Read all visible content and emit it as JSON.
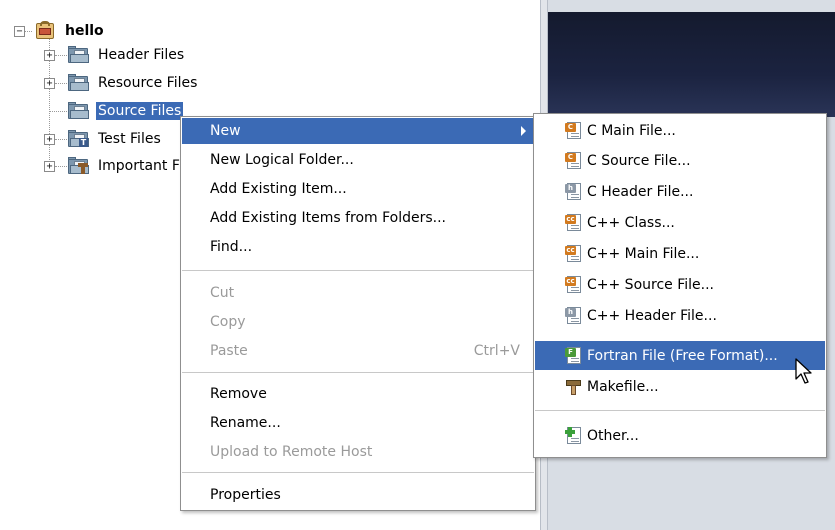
{
  "tree": {
    "root_label": "hello",
    "nodes": [
      {
        "label": "Header Files"
      },
      {
        "label": "Resource Files"
      },
      {
        "label": "Source Files"
      },
      {
        "label": "Test Files"
      },
      {
        "label": "Important Files"
      }
    ]
  },
  "context_menu": {
    "items": [
      {
        "label": "New"
      },
      {
        "label": "New Logical Folder..."
      },
      {
        "label": "Add Existing Item..."
      },
      {
        "label": "Add Existing Items from Folders..."
      },
      {
        "label": "Find..."
      },
      {
        "label": "Cut"
      },
      {
        "label": "Copy"
      },
      {
        "label": "Paste",
        "shortcut": "Ctrl+V"
      },
      {
        "label": "Remove"
      },
      {
        "label": "Rename..."
      },
      {
        "label": "Upload to Remote Host"
      },
      {
        "label": "Properties"
      }
    ]
  },
  "submenu": {
    "items": [
      {
        "label": "C Main File...",
        "icon": "c-file-icon"
      },
      {
        "label": "C Source File...",
        "icon": "c-file-icon"
      },
      {
        "label": "C Header File...",
        "icon": "h-file-icon"
      },
      {
        "label": "C++ Class...",
        "icon": "cpp-file-icon"
      },
      {
        "label": "C++ Main File...",
        "icon": "cpp-file-icon"
      },
      {
        "label": "C++ Source File...",
        "icon": "cpp-file-icon"
      },
      {
        "label": "C++ Header File...",
        "icon": "h-file-icon"
      },
      {
        "label": "Fortran File (Free Format)...",
        "icon": "fortran-file-icon"
      },
      {
        "label": "Makefile...",
        "icon": "hammer-icon"
      },
      {
        "label": "Other...",
        "icon": "new-file-plus-icon"
      }
    ]
  },
  "colors": {
    "selection": "#3b6ab5",
    "disabled_text": "#9a9a9a"
  }
}
